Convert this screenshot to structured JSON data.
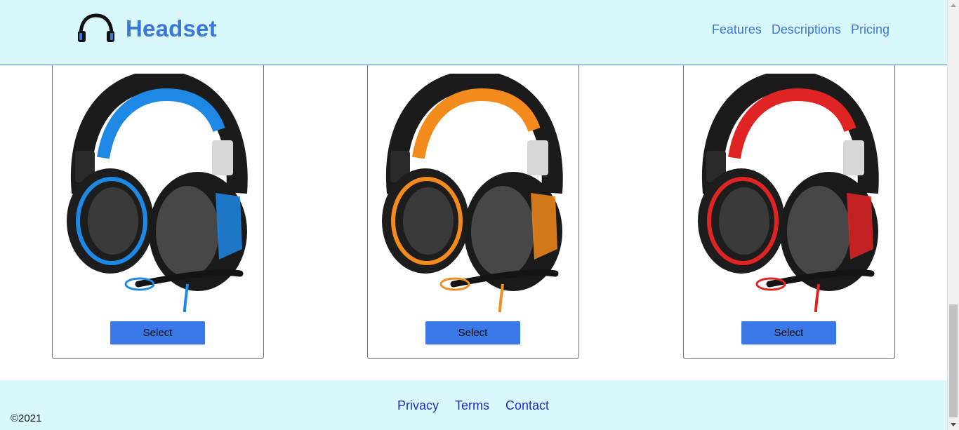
{
  "header": {
    "brand_name": "Headset",
    "nav": [
      "Features",
      "Descriptions",
      "Pricing"
    ]
  },
  "products": [
    {
      "accent_color": "#1e88e5",
      "button_label": "Select"
    },
    {
      "accent_color": "#f28a1c",
      "button_label": "Select"
    },
    {
      "accent_color": "#e02424",
      "button_label": "Select"
    }
  ],
  "footer": {
    "links": [
      "Privacy",
      "Terms",
      "Contact"
    ],
    "copyright": "©2021"
  },
  "colors": {
    "brand_blue": "#3a78d8",
    "header_bg": "#d9f8fd",
    "button_bg": "#3a78e8",
    "footer_link": "#1c2fcf"
  },
  "icons": {
    "brand": "headphones-icon"
  }
}
